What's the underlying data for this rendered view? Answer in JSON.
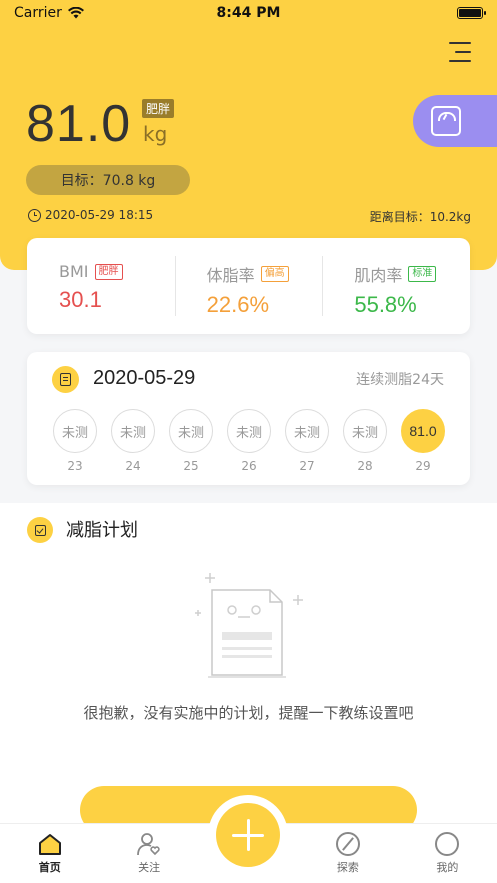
{
  "status_bar": {
    "carrier": "Carrier",
    "time": "8:44 PM"
  },
  "header": {
    "weight": "81.0",
    "weight_status": "肥胖",
    "unit": "kg",
    "target": "目标：70.8 kg",
    "datetime": "2020-05-29 18:15",
    "distance": "距离目标：10.2kg"
  },
  "metrics": [
    {
      "label": "BMI",
      "tag": "肥胖",
      "value": "30.1",
      "color": "#e5504f"
    },
    {
      "label": "体脂率",
      "tag": "偏高",
      "value": "22.6%",
      "color": "#f4a03a"
    },
    {
      "label": "肌肉率",
      "tag": "标准",
      "value": "55.8%",
      "color": "#3cb84a"
    }
  ],
  "history": {
    "date": "2020-05-29",
    "streak": "连续测脂24天",
    "days": [
      {
        "value": "未测",
        "day": "23"
      },
      {
        "value": "未测",
        "day": "24"
      },
      {
        "value": "未测",
        "day": "25"
      },
      {
        "value": "未测",
        "day": "26"
      },
      {
        "value": "未测",
        "day": "27"
      },
      {
        "value": "未测",
        "day": "28"
      },
      {
        "value": "81.0",
        "day": "29"
      }
    ]
  },
  "plan": {
    "title": "减脂计划",
    "empty_message": "很抱歉，没有实施中的计划，提醒一下教练设置吧"
  },
  "tabs": [
    {
      "label": "首页",
      "icon": "home-icon"
    },
    {
      "label": "关注",
      "icon": "person-heart-icon"
    },
    {
      "label": "探索",
      "icon": "compass-icon"
    },
    {
      "label": "我的",
      "icon": "user-icon"
    }
  ],
  "colors": {
    "accent": "#fdd143",
    "scale_tab": "#9b8ef0"
  }
}
